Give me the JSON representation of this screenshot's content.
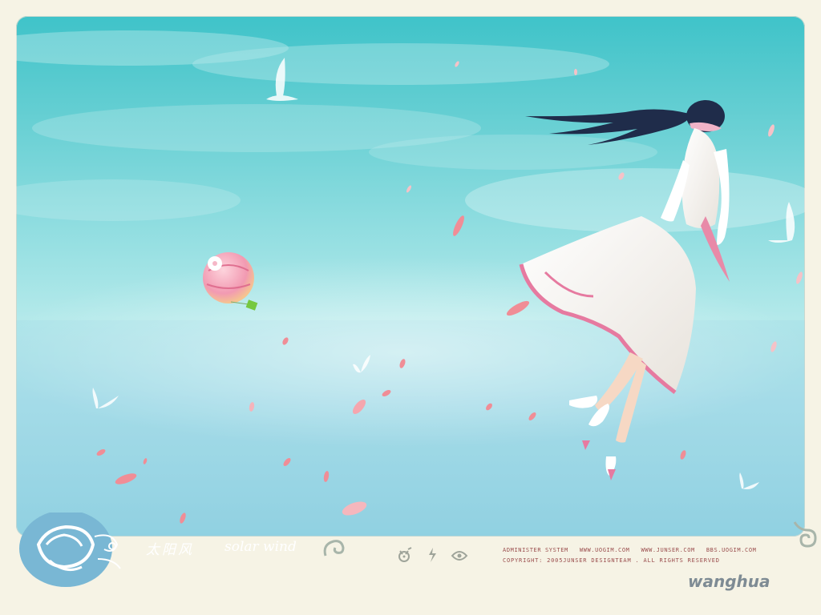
{
  "footer": {
    "title_cn": "太阳风",
    "title_en": "solar wind",
    "links": [
      "ADMINISTER SYSTEM",
      "WWW.UOGIM.COM",
      "WWW.JUNSER.COM",
      "BBS.UOGIM.COM"
    ],
    "copyright": "COPYRIGHT: 2005JUNSER DESIGNTEAM . ALL RIGHTS RESERVED",
    "author": "wanghua"
  },
  "icons": [
    "cat-icon",
    "lightning-icon",
    "eye-icon"
  ],
  "colors": {
    "sky_top": "#3fc3c9",
    "sky_bottom": "#8ccfe0",
    "page_background": "#f6f3e5",
    "petal": "#f08d96",
    "link_text": "#9a4d4d",
    "author_text": "#7e8b94"
  }
}
